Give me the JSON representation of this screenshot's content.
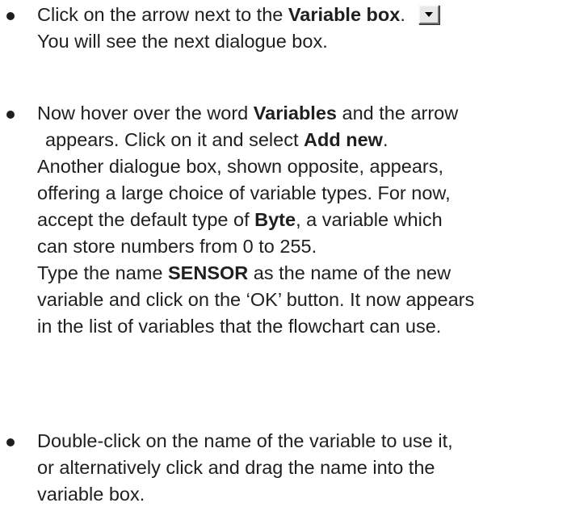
{
  "bullet1": {
    "line1_pre": "Click on the arrow next to the ",
    "line1_bold": "Variable box",
    "line1_post": ".",
    "line2": "You will see the next dialogue box.",
    "button_icon": "dropdown-arrow-icon"
  },
  "bullet2": {
    "l1_pre": "Now hover over the word ",
    "l1_bold": "Variables",
    "l1_post": " and the arrow",
    "l2_pre": "appears. Click on it and select ",
    "l2_bold": "Add new",
    "l2_post": ".",
    "l3": "Another dialogue box, shown opposite, appears,",
    "l4": "offering a large choice of variable types. For now,",
    "l5_pre": "accept the default type of ",
    "l5_bold": "Byte",
    "l5_post": ", a variable which",
    "l6": "can store numbers from 0 to 255.",
    "l7_pre": "Type the name ",
    "l7_bold": "SENSOR",
    "l7_post": " as the name of the new",
    "l8": "variable and click on the ‘OK’ button. It now appears",
    "l9": "in the list of variables that the flowchart can use."
  },
  "bullet3": {
    "l1": "Double-click on the name of the variable to use it,",
    "l2": "or alternatively click and drag the name into the",
    "l3": "variable box."
  }
}
